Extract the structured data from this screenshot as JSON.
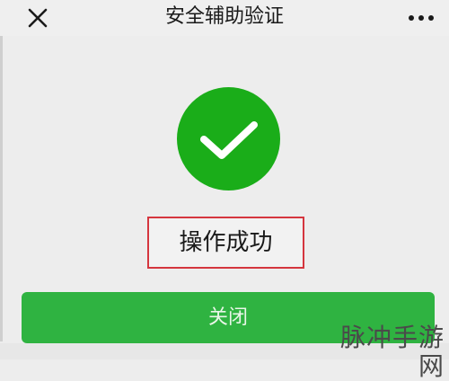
{
  "header": {
    "title": "安全辅助验证",
    "close_icon": "close-icon",
    "more_icon": "more-horizontal-icon"
  },
  "result": {
    "icon": "success-check-icon",
    "message": "操作成功"
  },
  "actions": {
    "close_label": "关闭"
  },
  "watermark": {
    "text": "脉冲手游网"
  },
  "colors": {
    "success_green": "#1aad19",
    "button_green": "#2fb341",
    "highlight_red": "#d5363e",
    "background": "#ededed"
  }
}
